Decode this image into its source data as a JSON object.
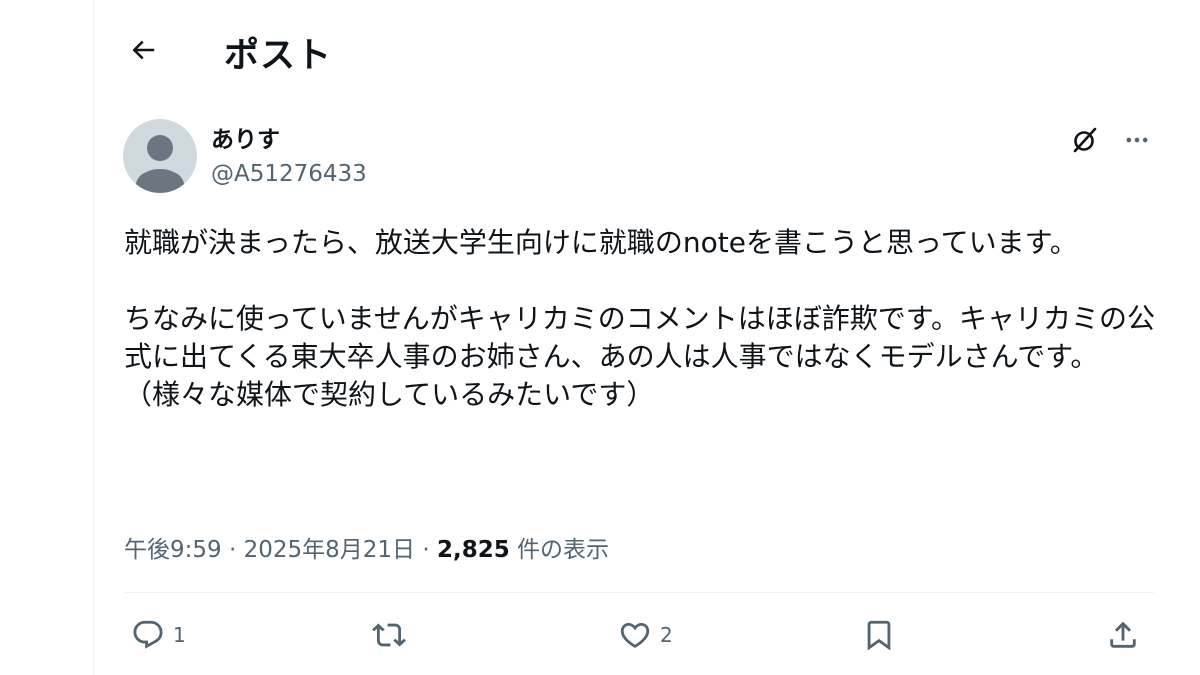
{
  "header": {
    "title": "ポスト",
    "back_icon": "arrow-left-icon"
  },
  "author": {
    "name": "ありす",
    "handle": "@A51276433",
    "avatar_icon": "default-avatar"
  },
  "post": {
    "paragraph1": "就職が決まったら、放送大学生向けに就職のnoteを書こうと思っています。",
    "paragraph2": "ちなみに使っていませんがキャリカミのコメントはほぼ詐欺です。キャリカミの公式に出てくる東大卒人事のお姉さん、あの人は人事ではなくモデルさんです。（様々な媒体で契約しているみたいです）"
  },
  "meta": {
    "time": "午後9:59",
    "separator": "·",
    "date": "2025年8月21日",
    "views_count": "2,825",
    "views_label": "件の表示"
  },
  "actions": {
    "reply_count": "1",
    "repost_count": "",
    "like_count": "2"
  },
  "colors": {
    "text_primary": "#0f1419",
    "text_secondary": "#536471",
    "divider": "#eff3f4",
    "avatar_bg": "#cfd9de",
    "avatar_fg": "#6b7780"
  }
}
